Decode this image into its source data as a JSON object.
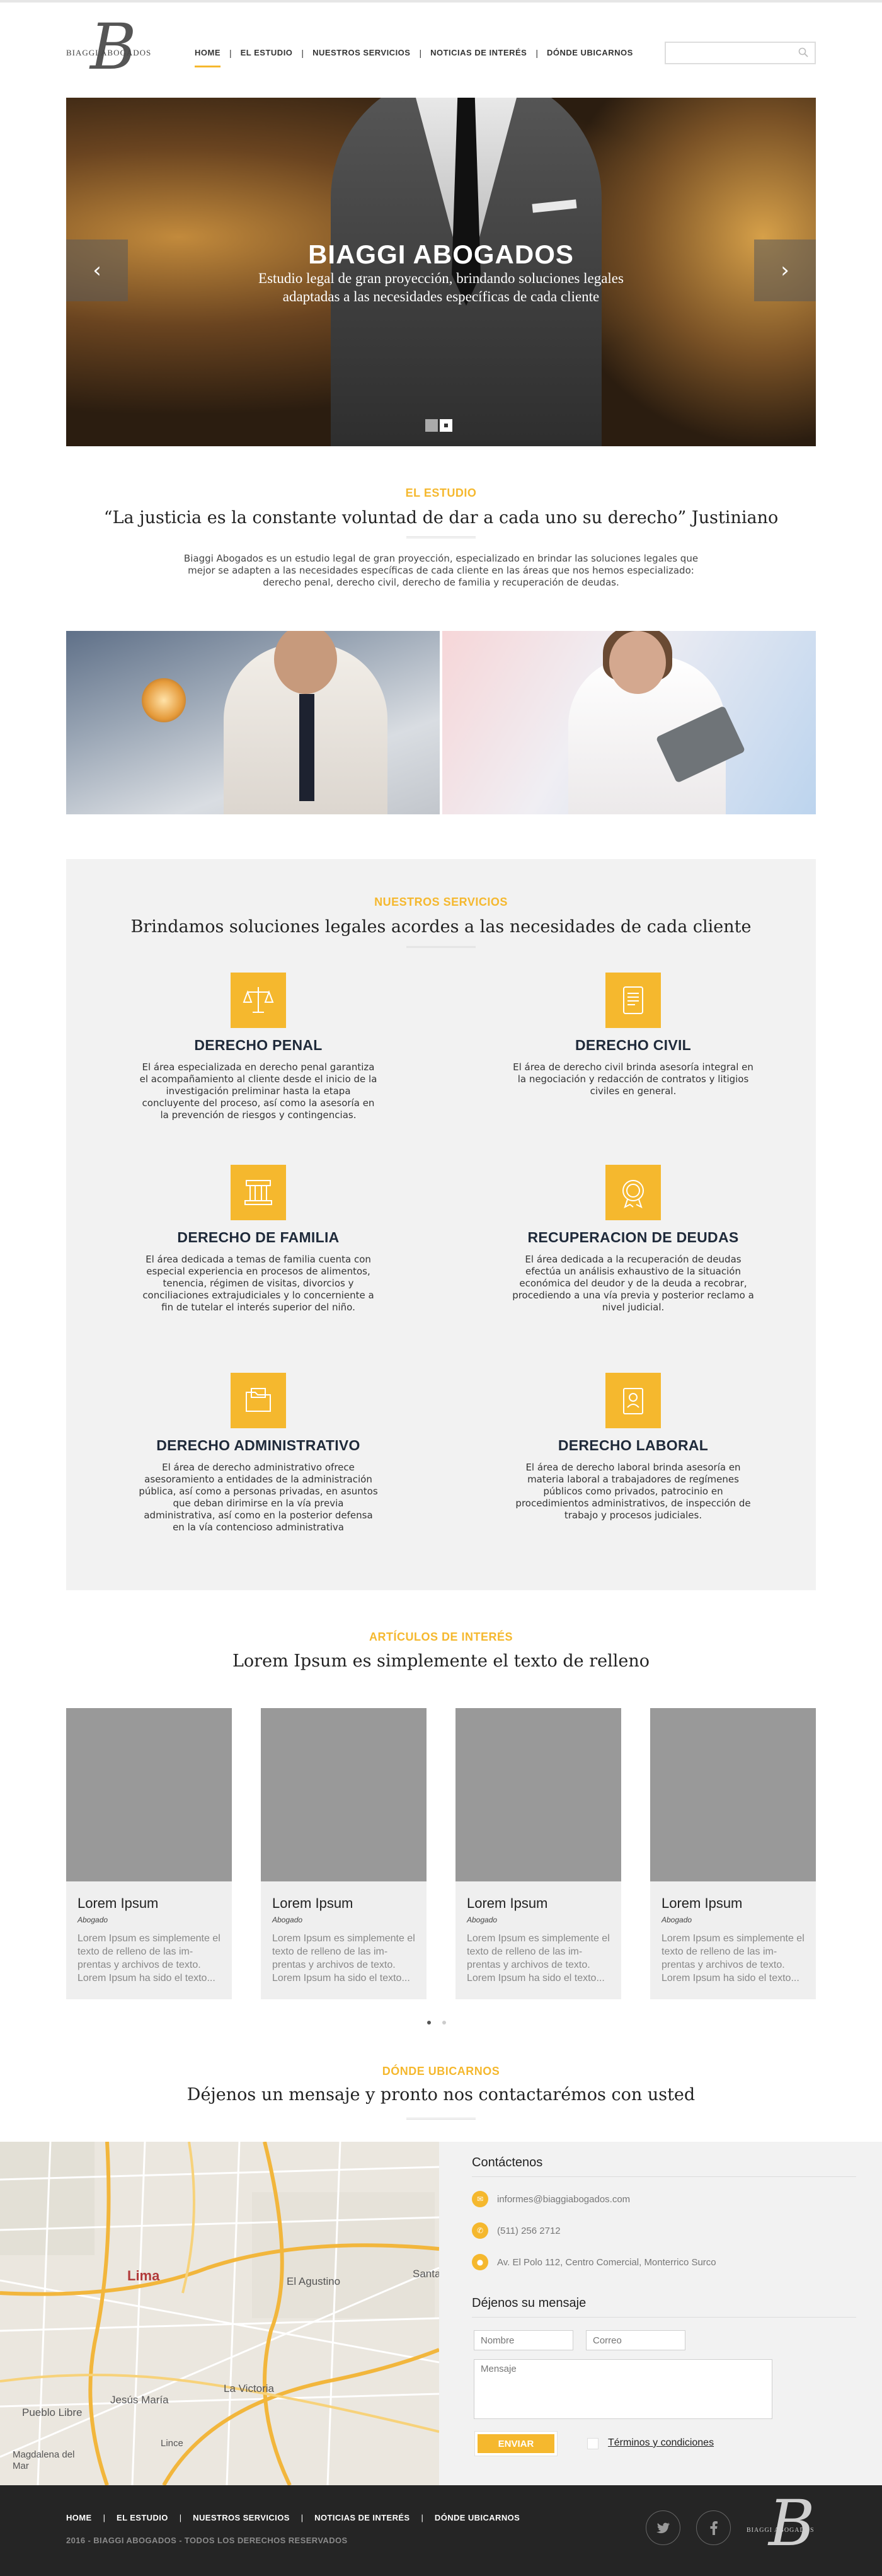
{
  "brand": {
    "wordmark": "BIAGGI ABOGADOS",
    "monogram": "B"
  },
  "nav": {
    "items": [
      "HOME",
      "EL ESTUDIO",
      "NUESTROS SERVICIOS",
      "NOTICIAS DE INTERÉS",
      "DÓNDE UBICARNOS"
    ],
    "active": "HOME",
    "separator": "|"
  },
  "search": {
    "placeholder": "",
    "icon": "search-icon"
  },
  "hero": {
    "title": "BIAGGI ABOGADOS",
    "subtitle_line1": "Estudio legal de gran proyección,  brindando soluciones legales",
    "subtitle_line2": "adaptadas a las necesidades específicas de cada cliente",
    "prev_icon": "‹",
    "next_icon": "›",
    "slides": 2,
    "active_slide": 2
  },
  "estudio": {
    "kicker": "EL ESTUDIO",
    "heading": "“La justicia es la constante voluntad de dar a cada uno su derecho”  Justiniano",
    "body_line1": "Biaggi Abogados es un estudio legal de gran proyección, especializado en brindar las soluciones legales que",
    "body_line2": "mejor se adapten a las necesidades específicas de cada cliente en las áreas que nos hemos especializado:",
    "body_line3": "derecho penal, derecho civil, derecho de familia y recuperación de deudas."
  },
  "services": {
    "kicker": "NUESTROS SERVICIOS",
    "heading": "Brindamos soluciones legales acordes a las necesidades de cada cliente",
    "items": [
      {
        "name": "DERECHO PENAL",
        "icon": "scales-icon",
        "desc": "El área especializada en derecho penal garantiza el acompañamiento al cliente desde el inicio de la investigación preliminar hasta la etapa concluyente del proceso, así como la asesoría en la prevención de riesgos y contingencias."
      },
      {
        "name": "DERECHO CIVIL",
        "icon": "scroll-icon",
        "desc": "El área de derecho civil brinda asesoría integral en la negociación y redacción de contratos y litigios civiles en general."
      },
      {
        "name": "DERECHO DE FAMILIA",
        "icon": "columns-icon",
        "desc": "El área dedicada a temas de familia cuenta con especial experiencia en procesos de alimentos, tenencia, régimen de visitas, divorcios y conciliaciones extrajudiciales y lo concerniente a fin de tutelar el interés superior del niño."
      },
      {
        "name": "RECUPERACION DE DEUDAS",
        "icon": "seal-icon",
        "desc": "El área dedicada a la recuperación de deudas efectúa un análisis exhaustivo de la situación económica del deudor y de la deuda a recobrar, procediendo a una vía previa y posterior reclamo a nivel judicial."
      },
      {
        "name": "DERECHO ADMINISTRATIVO",
        "icon": "folder-icon",
        "desc": "El área de derecho administrativo ofrece asesoramiento a entidades de la administración pública, así como a personas privadas, en asuntos que deban dirimirse en la vía previa administrativa, así como en la posterior defensa en la vía contencioso administrativa"
      },
      {
        "name": "DERECHO LABORAL",
        "icon": "badge-icon",
        "desc": "El área de derecho laboral brinda asesoría en materia laboral a trabajadores de regímenes públicos como privados, patrocinio en procedimientos administrativos, de inspección de trabajo y procesos judiciales."
      }
    ]
  },
  "articles": {
    "kicker": "ARTÍCULOS DE INTERÉS",
    "heading": "Lorem Ipsum es simplemente el texto de relleno",
    "cards": [
      {
        "title": "Lorem Ipsum",
        "author": "Abogado",
        "excerpt": "Lorem Ipsum es simplemente el texto de relleno de las im-prentas y archivos de texto. Lorem Ipsum ha sido el texto..."
      },
      {
        "title": "Lorem Ipsum",
        "author": "Abogado",
        "excerpt": "Lorem Ipsum es simplemente el texto de relleno de las im-prentas y archivos de texto. Lorem Ipsum ha sido el texto..."
      },
      {
        "title": "Lorem Ipsum",
        "author": "Abogado",
        "excerpt": "Lorem Ipsum es simplemente el texto de relleno de las im-prentas y archivos de texto. Lorem Ipsum ha sido el texto..."
      },
      {
        "title": "Lorem Ipsum",
        "author": "Abogado",
        "excerpt": "Lorem Ipsum es simplemente el texto de relleno de las im-prentas y archivos de texto. Lorem Ipsum ha sido el texto..."
      }
    ],
    "pages": 2,
    "active_page": 1
  },
  "location": {
    "kicker": "DÓNDE UBICARNOS",
    "heading": "Déjenos un mensaje y pronto nos contactarémos con usted",
    "map_labels": [
      "Lima",
      "El Agustino",
      "Jesús María",
      "La Victoria",
      "Pueblo Libre",
      "Lince",
      "Magdalena del Mar",
      "Santa"
    ]
  },
  "contact": {
    "title": "Contáctenos",
    "email": "informes@biaggiabogados.com",
    "phone": "(511) 256 2712",
    "address": "Av. El Polo 112, Centro Comercial, Monterrico Surco",
    "form_title": "Déjenos su mensaje",
    "name_placeholder": "Nombre",
    "email_placeholder": "Correo",
    "message_placeholder": "Mensaje",
    "send_label": "ENVIAR",
    "terms_label": "Términos y condiciones"
  },
  "footer": {
    "nav": [
      "HOME",
      "EL ESTUDIO",
      "NUESTROS SERVICIOS",
      "NOTICIAS DE INTERÉS",
      "DÓNDE UBICARNOS"
    ],
    "copyright": "2016 - BIAGGI ABOGADOS - TODOS LOS DERECHOS RESERVADOS",
    "social": [
      "twitter-icon",
      "facebook-icon"
    ]
  },
  "colors": {
    "accent": "#f5b82e",
    "services_bg": "#f2f2f2",
    "footer_bg": "#252525",
    "thumb_gray": "#999999"
  }
}
